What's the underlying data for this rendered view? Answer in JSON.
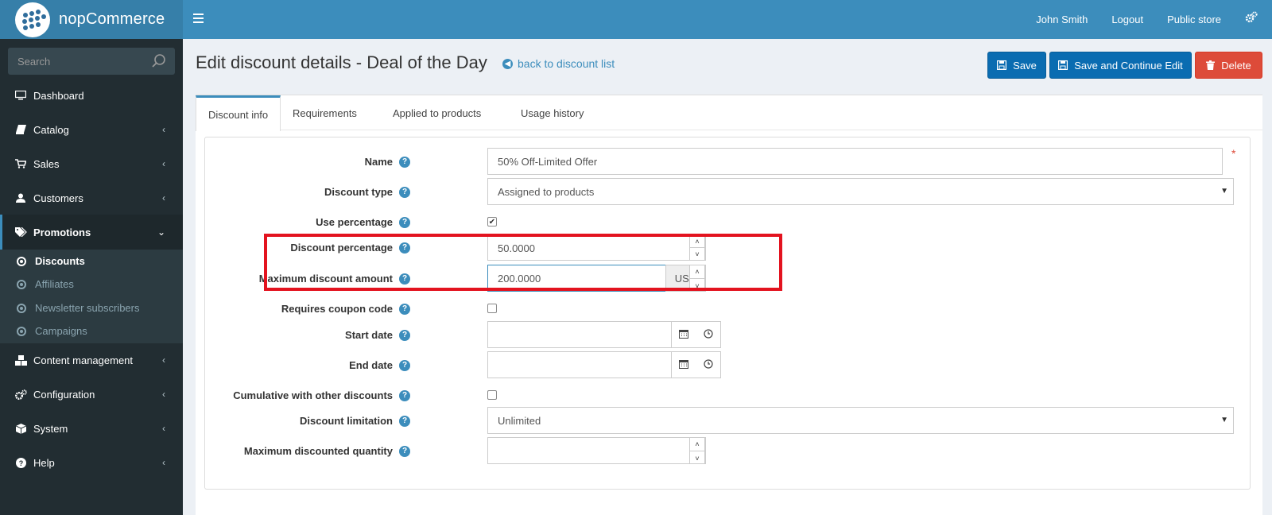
{
  "app": {
    "name": "nopCommerce"
  },
  "header": {
    "user": "John Smith",
    "logout": "Logout",
    "public_store": "Public store",
    "menu_icon": "hamburger-icon",
    "settings_icon": "gears-icon"
  },
  "sidebar": {
    "search_placeholder": "Search",
    "items": [
      {
        "label": "Dashboard",
        "icon": "monitor-icon"
      },
      {
        "label": "Catalog",
        "icon": "book-icon"
      },
      {
        "label": "Sales",
        "icon": "cart-icon"
      },
      {
        "label": "Customers",
        "icon": "user-icon"
      },
      {
        "label": "Promotions",
        "icon": "tags-icon"
      },
      {
        "label": "Content management",
        "icon": "cubes-icon"
      },
      {
        "label": "Configuration",
        "icon": "gears-icon"
      },
      {
        "label": "System",
        "icon": "cube-icon"
      },
      {
        "label": "Help",
        "icon": "question-icon"
      }
    ],
    "promotions_sub": [
      "Discounts",
      "Affiliates",
      "Newsletter subscribers",
      "Campaigns"
    ]
  },
  "page": {
    "title": "Edit discount details - Deal of the Day",
    "back_link": "back to discount list",
    "save": "Save",
    "save_continue": "Save and Continue Edit",
    "delete": "Delete"
  },
  "tabs": [
    "Discount info",
    "Requirements",
    "Applied to products",
    "Usage history"
  ],
  "form": {
    "name_label": "Name",
    "name_value": "50% Off-Limited Offer",
    "type_label": "Discount type",
    "type_value": "Assigned to products",
    "use_pct_label": "Use percentage",
    "use_pct_checked": true,
    "pct_label": "Discount percentage",
    "pct_value": "50.0000",
    "max_amount_label": "Maximum discount amount",
    "max_amount_value": "200.0000",
    "currency": "USD",
    "coupon_label": "Requires coupon code",
    "coupon_checked": false,
    "start_label": "Start date",
    "start_value": "",
    "end_label": "End date",
    "end_value": "",
    "cumulative_label": "Cumulative with other discounts",
    "cumulative_checked": false,
    "limitation_label": "Discount limitation",
    "limitation_value": "Unlimited",
    "max_qty_label": "Maximum discounted quantity",
    "max_qty_value": "",
    "required_mark": "*"
  },
  "colors": {
    "header": "#3c8dbc",
    "sidebar": "#222d32",
    "primary_button": "#0a6cb1",
    "danger_button": "#dd4b39",
    "highlight_box": "#e3131f"
  }
}
